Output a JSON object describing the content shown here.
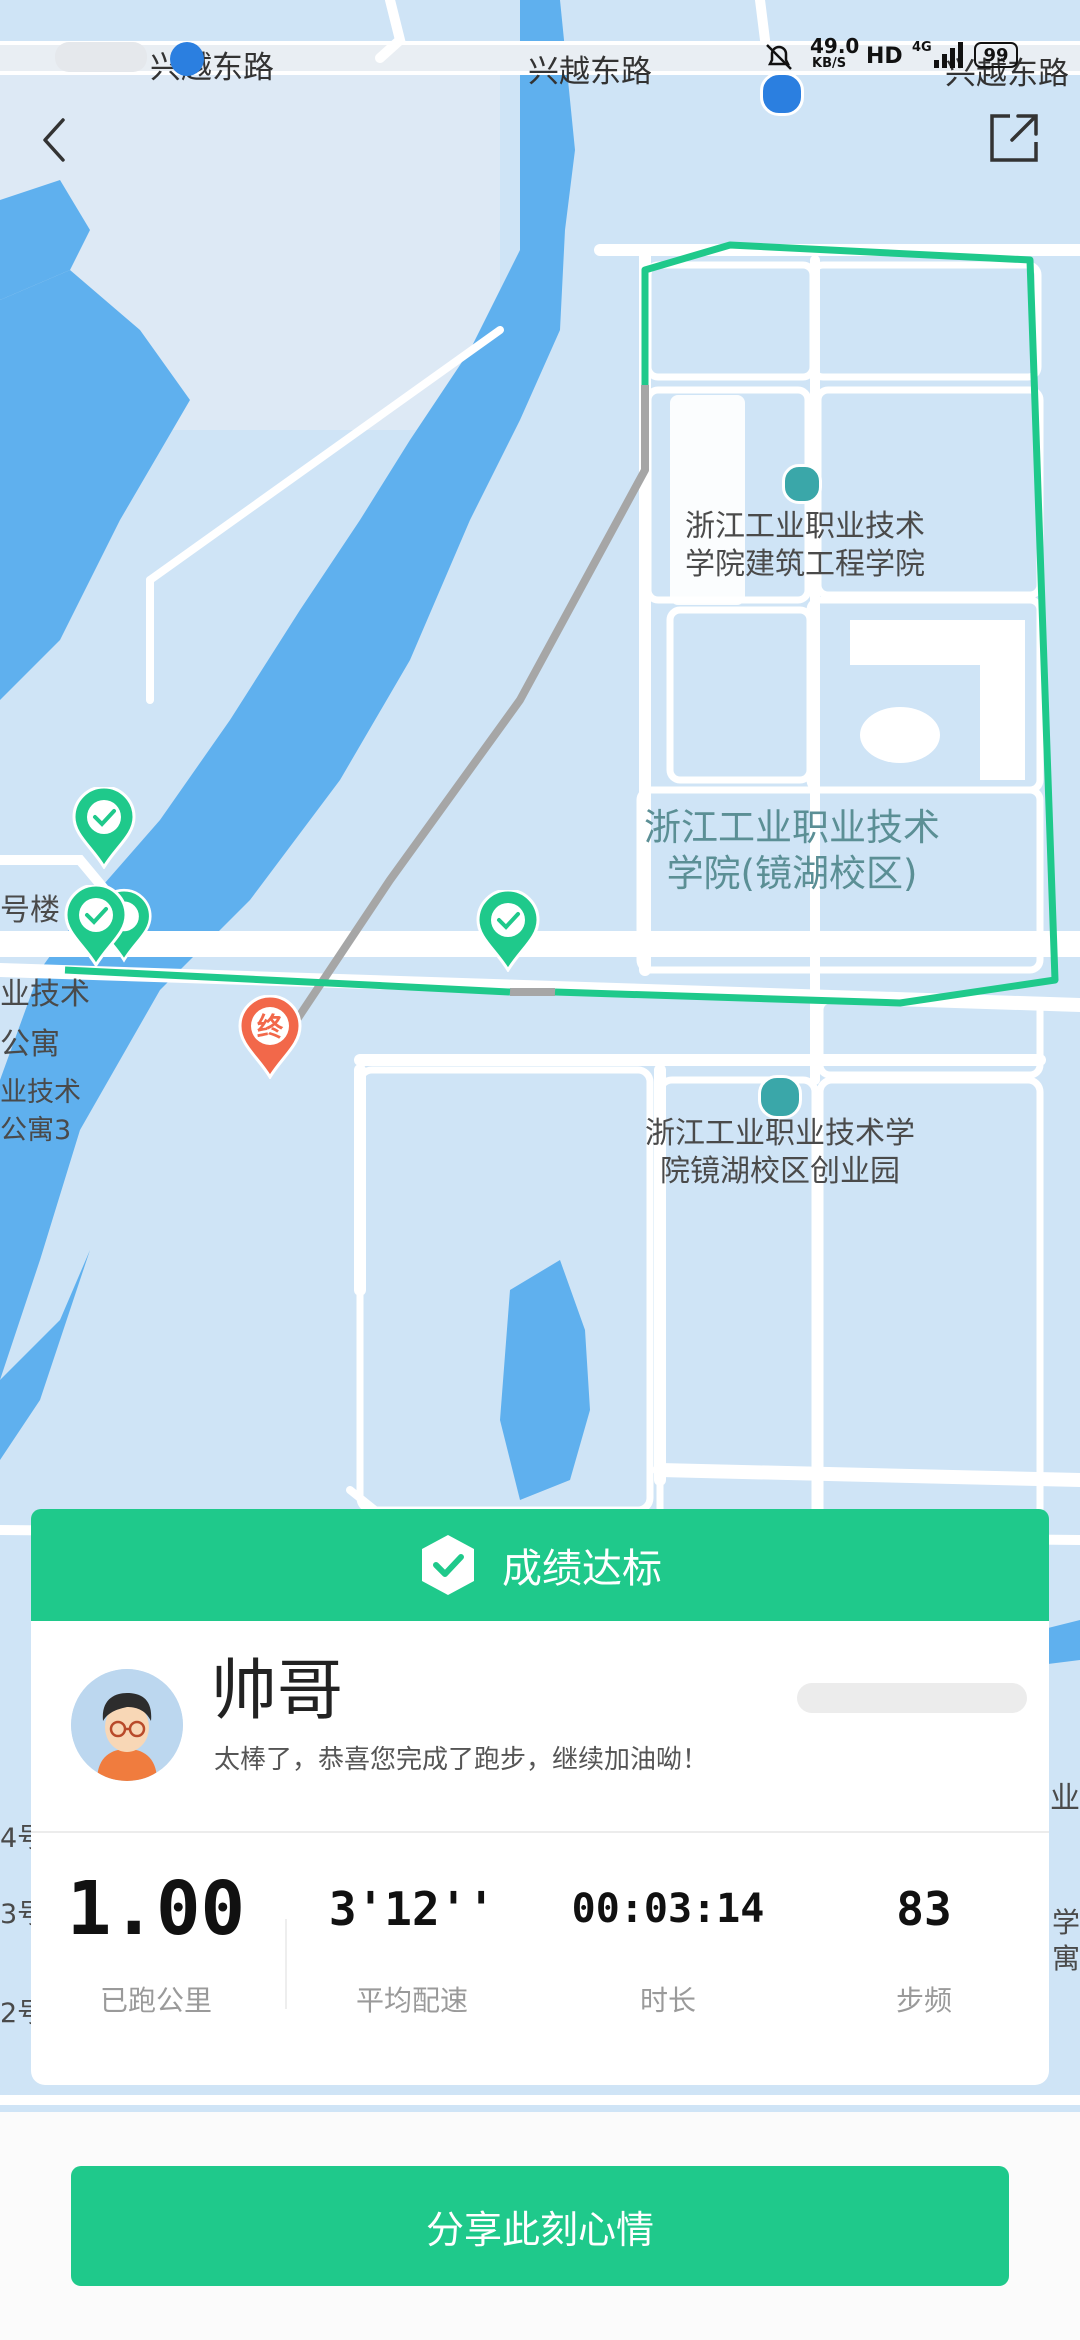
{
  "status_bar": {
    "net_speed_value": "49.0",
    "net_speed_unit": "KB/S",
    "hd_label": "HD",
    "network": "4G",
    "battery": "99"
  },
  "map": {
    "roads": [
      "兴越东路",
      "兴越东路",
      "兴越东路"
    ],
    "pois": [
      {
        "line1": "浙江工业职业技术",
        "line2": "学院建筑工程学院"
      },
      {
        "line1": "浙江工业职业技术",
        "line2": "学院(镜湖校区)"
      },
      {
        "line1": "浙江工业职业技术学",
        "line2": "院镜湖校区创业园"
      }
    ],
    "edge_labels": [
      "号楼",
      "业技术",
      "公寓",
      "业技术",
      "公寓3",
      "4号",
      "3号",
      "2号",
      "业",
      "学",
      "寓"
    ],
    "end_marker": "终",
    "colors": {
      "route": "#1fc98b",
      "connector": "#a6a6a6",
      "water": "#5fb0ee",
      "land": "#cfe4f6",
      "end": "#f2684a"
    }
  },
  "result": {
    "banner": "成绩达标",
    "user_name": "帅哥",
    "message": "太棒了，恭喜您完成了跑步，继续加油呦！",
    "stats": [
      {
        "value": "1.00",
        "label": "已跑公里"
      },
      {
        "value": "3'12''",
        "label": "平均配速"
      },
      {
        "value": "00:03:14",
        "label": "时长"
      },
      {
        "value": "83",
        "label": "步频"
      }
    ]
  },
  "share_button": "分享此刻心情"
}
